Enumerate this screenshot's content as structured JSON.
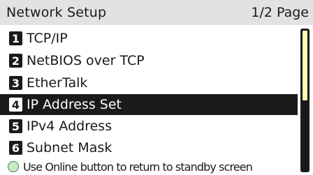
{
  "header": {
    "title": "Network Setup",
    "page_indicator": "1/2 Page"
  },
  "menu": {
    "items": [
      {
        "number": "1",
        "label": "TCP/IP",
        "selected": false
      },
      {
        "number": "2",
        "label": "NetBIOS over TCP",
        "selected": false
      },
      {
        "number": "3",
        "label": "EtherTalk",
        "selected": false
      },
      {
        "number": "4",
        "label": "IP Address Set",
        "selected": true
      },
      {
        "number": "5",
        "label": "IPv4 Address",
        "selected": false
      },
      {
        "number": "6",
        "label": "Subnet Mask",
        "selected": false
      }
    ]
  },
  "scrollbar": {
    "visible_fraction": 0.5,
    "position_fraction": 0
  },
  "footer": {
    "icon": "online-button-icon",
    "hint": "Use Online button to return to standby screen"
  },
  "colors": {
    "header_bg": "#e2e2e2",
    "selected_bg": "#1a1a1a",
    "scroll_thumb": "#fffcab",
    "online_icon": "#c8ecc2"
  }
}
